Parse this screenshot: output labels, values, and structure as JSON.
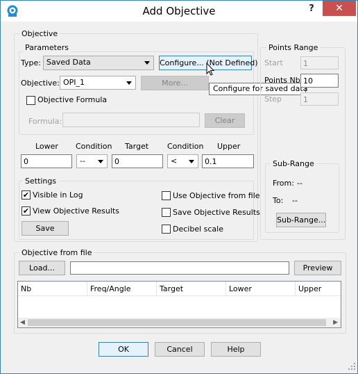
{
  "window": {
    "title": "Add Objective",
    "help_label": "?",
    "close_label": "✕"
  },
  "objective_group": {
    "title": "Objective",
    "parameters": {
      "title": "Parameters",
      "type_label": "Type:",
      "type_value": "Saved Data",
      "configure_label": "Configure... (Not Defined)",
      "tooltip": "Configure for saved data",
      "objective_label": "Objective:",
      "objective_value": "OPI_1",
      "more_label": "More...",
      "formula_checkbox_label": "Objective Formula",
      "formula_checked": false,
      "formula_label": "Formula:",
      "formula_value": "",
      "clear_label": "Clear"
    },
    "limits": {
      "lower_label": "Lower",
      "lower_value": "0",
      "condition1_label": "Condition",
      "condition1_value": "--",
      "target_label": "Target",
      "target_value": "0",
      "condition2_label": "Condition",
      "condition2_value": "<",
      "upper_label": "Upper",
      "upper_value": "0.1"
    },
    "settings": {
      "title": "Settings",
      "visible_in_log": {
        "label": "Visible in Log",
        "checked": true
      },
      "view_results": {
        "label": "View Objective Results",
        "checked": true
      },
      "use_from_file": {
        "label": "Use Objective from file",
        "checked": false
      },
      "save_results": {
        "label": "Save Objective Results",
        "checked": false
      },
      "decibel_scale": {
        "label": "Decibel scale",
        "checked": false
      },
      "save_label": "Save"
    }
  },
  "points_range": {
    "title": "Points Range",
    "start_label": "Start",
    "start_value": "1",
    "points_nb_label": "Points Nb",
    "points_nb_value": "10",
    "step_label": "Step",
    "step_value": "1",
    "subrange": {
      "title": "Sub-Range",
      "from_label": "From:",
      "from_value": "--",
      "to_label": "To:",
      "to_value": "--",
      "button_label": "Sub-Range..."
    }
  },
  "file_group": {
    "title": "Objective from file",
    "load_label": "Load...",
    "path_value": "",
    "preview_label": "Preview",
    "columns": [
      "Nb",
      "Freq/Angle",
      "Target",
      "Lower",
      "Upper"
    ]
  },
  "footer": {
    "ok_label": "OK",
    "cancel_label": "Cancel",
    "help_label": "Help"
  },
  "checkmark": "✔"
}
